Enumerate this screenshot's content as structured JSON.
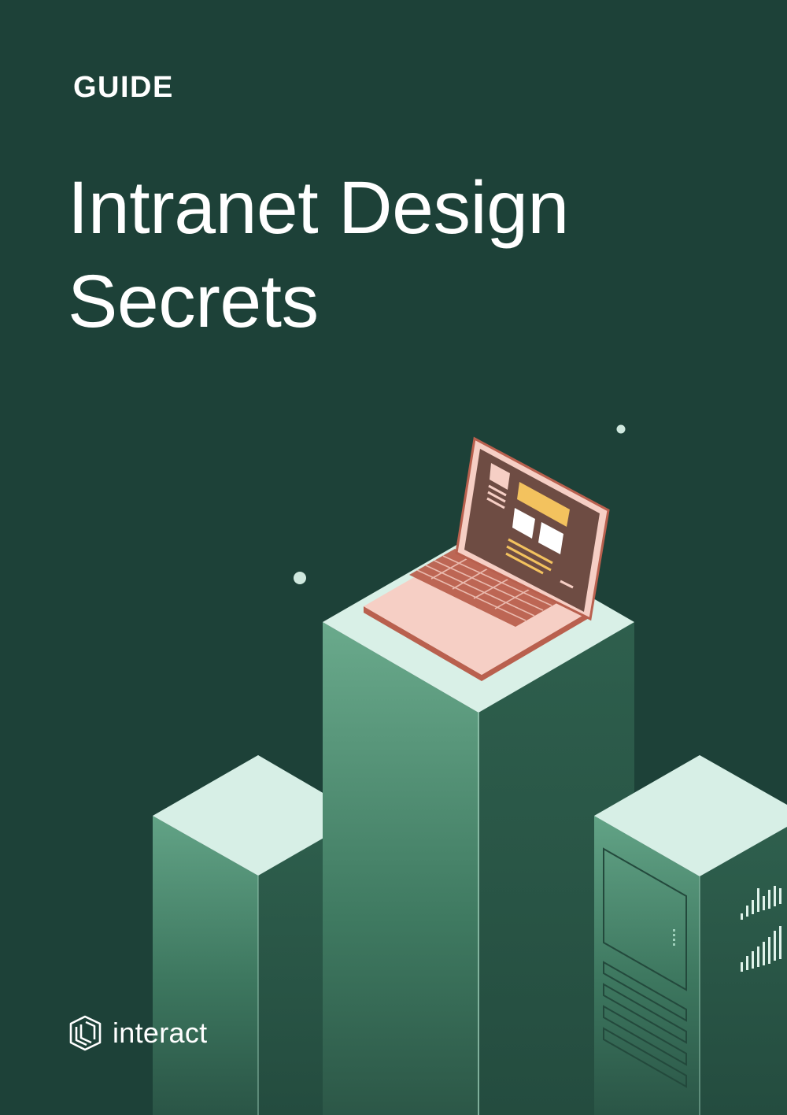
{
  "cover": {
    "label": "GUIDE",
    "title_lines": [
      "Intranet Design",
      "Secrets"
    ],
    "brand": {
      "name": "interact",
      "icon": "interact-logo-icon"
    }
  },
  "colors": {
    "background": "#1d4138",
    "text": "#ffffff",
    "pillar_top": "#d6efe6",
    "pillar_side_light": "#5fa384",
    "pillar_side_dark": "#2d5e4d",
    "laptop_body": "#f6cfc5",
    "laptop_screen": "#6e4c43",
    "laptop_keys": "#b9604e",
    "screen_accent": "#f3c25e"
  },
  "illustration": {
    "subject": "laptop on top of isometric server pillars",
    "icons": [
      "laptop-icon",
      "server-rack-icon",
      "bar-chart-icon"
    ]
  }
}
